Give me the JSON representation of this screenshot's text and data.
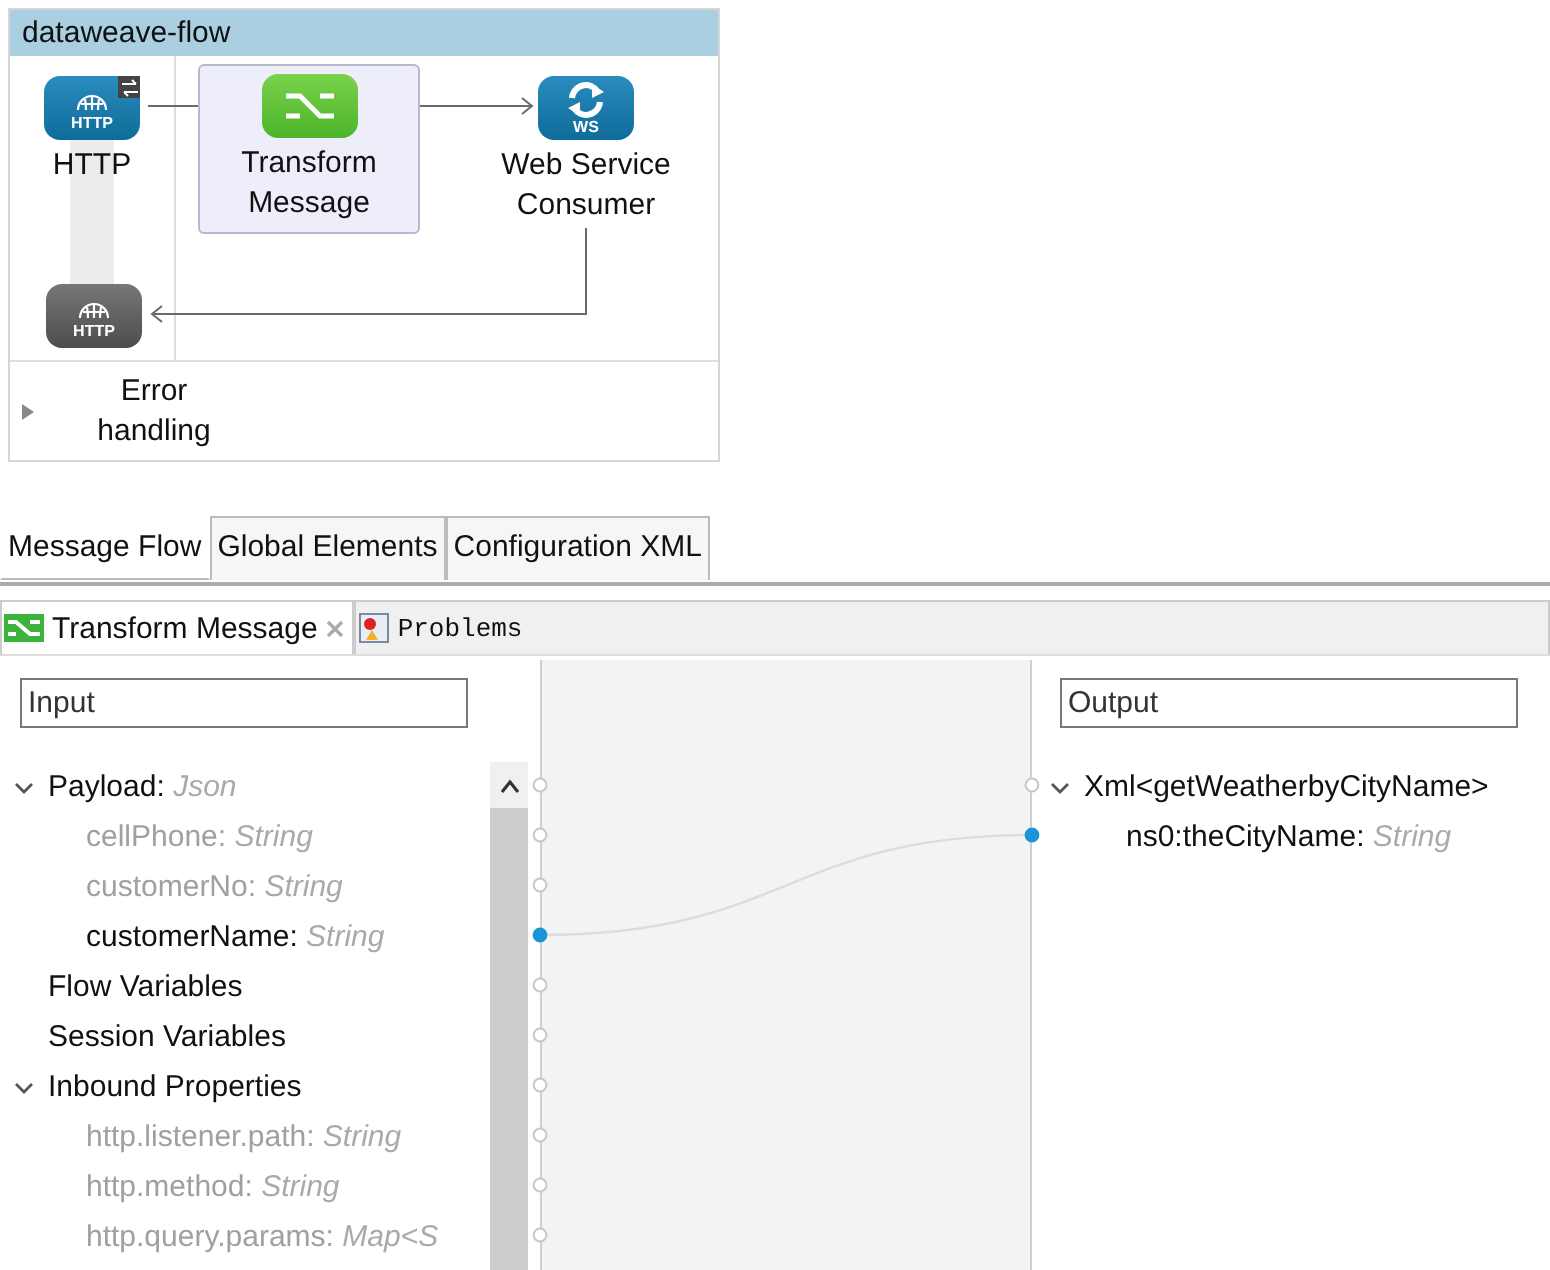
{
  "flow": {
    "title": "dataweave-flow",
    "nodes": [
      {
        "kind": "http",
        "label": "HTTP",
        "icon_text": "HTTP",
        "selected": false
      },
      {
        "kind": "transform",
        "label": "Transform Message",
        "selected": true
      },
      {
        "kind": "ws",
        "label": "Web Service Consumer",
        "icon_text": "WS",
        "selected": false
      },
      {
        "kind": "http-response",
        "icon_text": "HTTP",
        "selected": false
      }
    ],
    "error_handling": {
      "label": "Error handling",
      "expanded": false
    }
  },
  "editor_tabs": [
    {
      "label": "Message Flow",
      "selected": true
    },
    {
      "label": "Global Elements",
      "selected": false
    },
    {
      "label": "Configuration XML",
      "selected": false
    }
  ],
  "view_tabs": [
    {
      "label": "Transform Message",
      "kind": "transform",
      "selected": true,
      "closable": true
    },
    {
      "label": "Problems",
      "kind": "problems",
      "selected": false,
      "closable": false
    }
  ],
  "input_panel": {
    "title": "Input",
    "tree": [
      {
        "name": "Payload",
        "separator": ":",
        "type": "Json",
        "expanded": true,
        "children": [
          {
            "name": "cellPhone",
            "separator": ":",
            "type": "String",
            "mapped": false
          },
          {
            "name": "customerNo",
            "separator": ":",
            "type": "String",
            "mapped": false
          },
          {
            "name": "customerName",
            "separator": ":",
            "type": "String",
            "mapped": true
          }
        ]
      },
      {
        "name": "Flow Variables"
      },
      {
        "name": "Session Variables"
      },
      {
        "name": "Inbound Properties",
        "expanded": true,
        "children": [
          {
            "name": "http.listener.path",
            "separator": ":",
            "type": "String",
            "mapped": false
          },
          {
            "name": "http.method",
            "separator": ":",
            "type": "String",
            "mapped": false
          },
          {
            "name": "http.query.params",
            "separator": ":",
            "type": "Map<S",
            "mapped": false
          }
        ]
      }
    ]
  },
  "output_panel": {
    "title": "Output",
    "tree": [
      {
        "name": "Xml<getWeatherbyCityName>",
        "expanded": true,
        "children": [
          {
            "name": "ns0:theCityName",
            "separator": ":",
            "type": "String",
            "mapped": true
          }
        ]
      }
    ]
  }
}
